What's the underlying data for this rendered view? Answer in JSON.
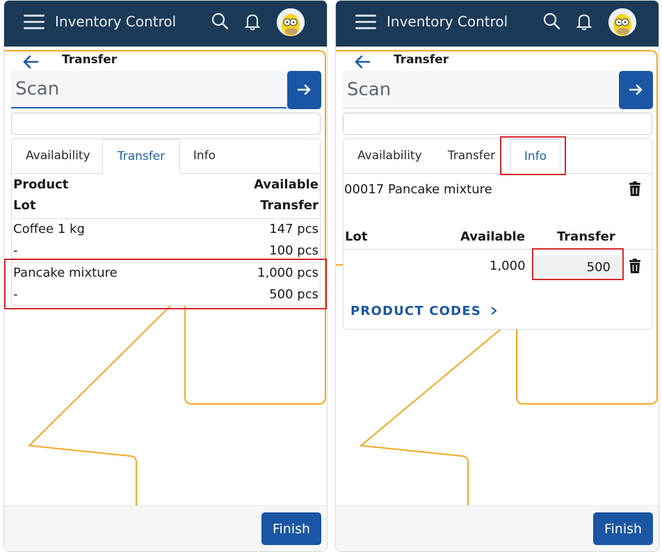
{
  "app": {
    "title": "Inventory Control"
  },
  "page": {
    "title": "Transfer"
  },
  "scan": {
    "placeholder": "Scan"
  },
  "tabs": [
    "Availability",
    "Transfer",
    "Info"
  ],
  "left": {
    "active_tab": "Transfer",
    "header": {
      "col1": "Product",
      "col2": "Available",
      "col3": "Lot",
      "col4": "Transfer"
    },
    "rows": [
      {
        "product": "Coffee 1 kg",
        "available": "147 pcs",
        "lot": "-",
        "transfer": "100 pcs"
      },
      {
        "product": "Pancake mixture",
        "available": "1,000 pcs",
        "lot": "-",
        "transfer": "500 pcs"
      }
    ]
  },
  "right": {
    "active_tab": "Info",
    "product": "00017 Pancake mixture",
    "headers": {
      "lot": "Lot",
      "available": "Available",
      "transfer": "Transfer"
    },
    "row": {
      "available": "1,000",
      "transfer": "500"
    },
    "product_codes": "PRODUCT CODES"
  },
  "finish_label": "Finish",
  "colors": {
    "appbar": "#1b3a57",
    "accent": "#1a56a3",
    "highlight": "#d6262b",
    "deco": "#f5a623"
  },
  "icons": [
    "menu-icon",
    "search-icon",
    "bell-icon",
    "avatar",
    "back-arrow-icon",
    "arrow-right-icon",
    "trash-icon",
    "chevron-right-icon"
  ]
}
